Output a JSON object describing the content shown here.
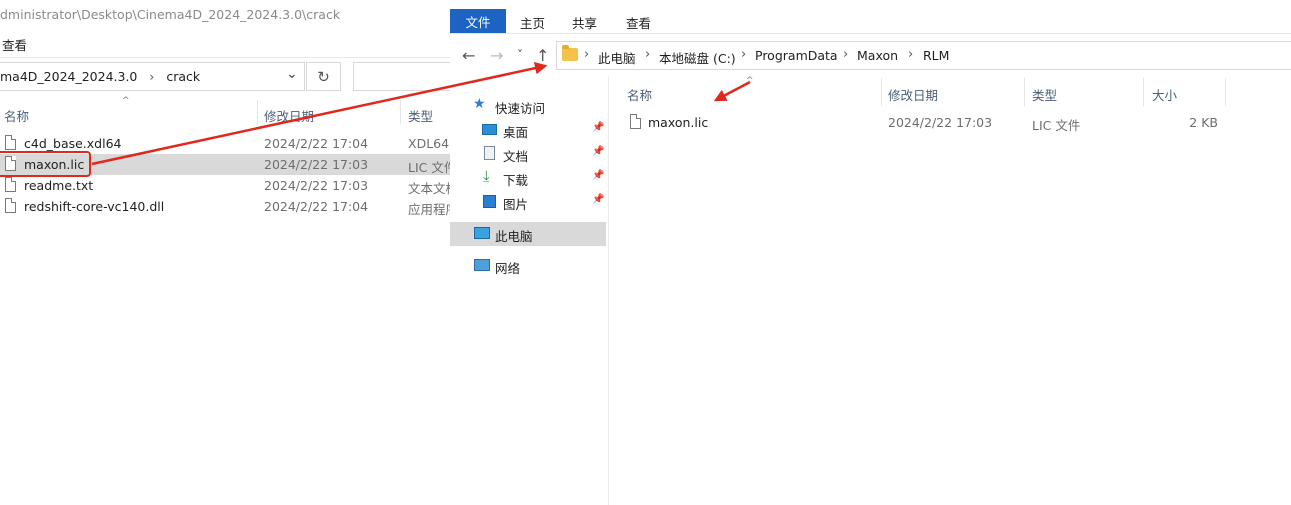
{
  "left_window": {
    "title_path": "dministrator\\Desktop\\Cinema4D_2024_2024.3.0\\crack",
    "menu_view": "查看",
    "address_crumb_1": "ma4D_2024_2024.3.0",
    "address_sep": "›",
    "address_crumb_2": "crack",
    "chevron_icon": "chevron-down-icon",
    "refresh_icon": "refresh-icon",
    "columns": {
      "name": "名称",
      "date": "修改日期",
      "type": "类型"
    },
    "files": [
      {
        "name": "c4d_base.xdl64",
        "date": "2024/2/22 17:04",
        "type": "XDL64"
      },
      {
        "name": "maxon.lic",
        "date": "2024/2/22 17:03",
        "type": "LIC 文件"
      },
      {
        "name": "readme.txt",
        "date": "2024/2/22 17:03",
        "type": "文本文档"
      },
      {
        "name": "redshift-core-vc140.dll",
        "date": "2024/2/22 17:04",
        "type": "应用程序扩展"
      }
    ],
    "selected_index": 1,
    "highlight_color": "#e0281e"
  },
  "right_window": {
    "ribbon": {
      "file": "文件",
      "home": "主页",
      "share": "共享",
      "view": "查看"
    },
    "ribbon_accent": "#1c63c2",
    "nav_buttons": {
      "back": "←",
      "forward": "→",
      "recent": "˅",
      "up": "↑"
    },
    "breadcrumb": [
      "此电脑",
      "本地磁盘 (C:)",
      "ProgramData",
      "Maxon",
      "RLM"
    ],
    "breadcrumb_sep": "›",
    "nav_pane": {
      "quick_access": "快速访问",
      "desktop": "桌面",
      "documents": "文档",
      "downloads": "下载",
      "pictures": "图片",
      "this_pc": "此电脑",
      "network": "网络"
    },
    "columns": {
      "name": "名称",
      "date": "修改日期",
      "type": "类型",
      "size": "大小"
    },
    "files": [
      {
        "name": "maxon.lic",
        "date": "2024/2/22 17:03",
        "type": "LIC 文件",
        "size": "2 KB"
      }
    ]
  }
}
